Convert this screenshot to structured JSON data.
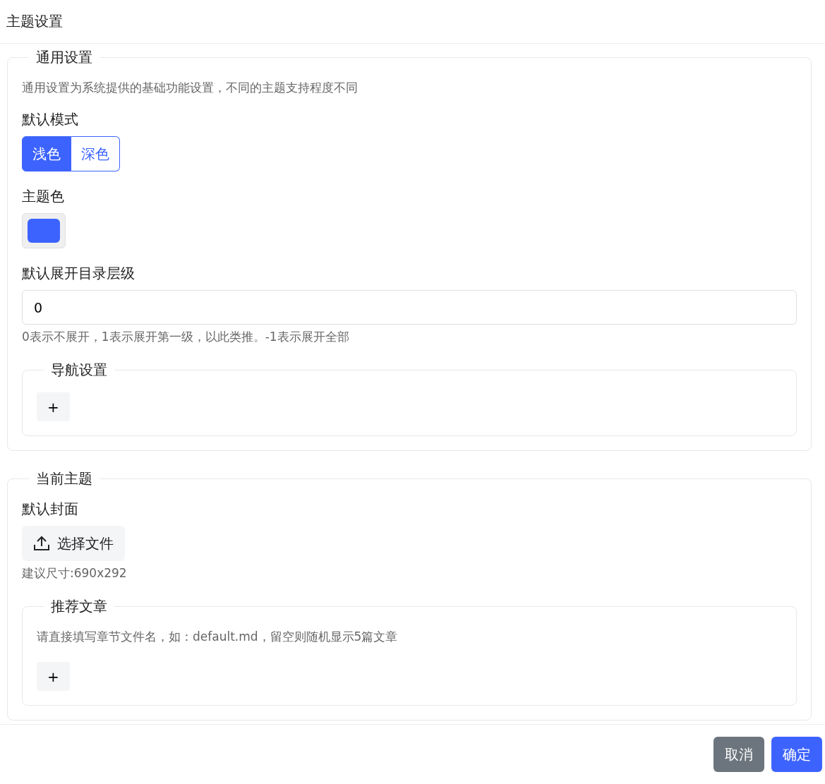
{
  "dialog": {
    "title": "主题设置"
  },
  "general": {
    "legend": "通用设置",
    "description": "通用设置为系统提供的基础功能设置，不同的主题支持程度不同",
    "mode": {
      "label": "默认模式",
      "options": [
        {
          "label": "浅色",
          "selected": true
        },
        {
          "label": "深色",
          "selected": false
        }
      ]
    },
    "theme_color": {
      "label": "主题色",
      "color": "#3d63ff"
    },
    "toc_level": {
      "label": "默认展开目录层级",
      "value": "0",
      "hint": "0表示不展开，1表示展开第一级，以此类推。-1表示展开全部"
    },
    "nav": {
      "legend": "导航设置",
      "add": "+"
    }
  },
  "current_theme": {
    "legend": "当前主题",
    "cover": {
      "label": "默认封面",
      "button": "选择文件",
      "hint": "建议尺寸:690x292"
    },
    "recommended": {
      "legend": "推荐文章",
      "description": "请直接填写章节文件名，如：default.md，留空则随机显示5篇文章",
      "add": "+"
    }
  },
  "footer": {
    "cancel": "取消",
    "confirm": "确定"
  }
}
